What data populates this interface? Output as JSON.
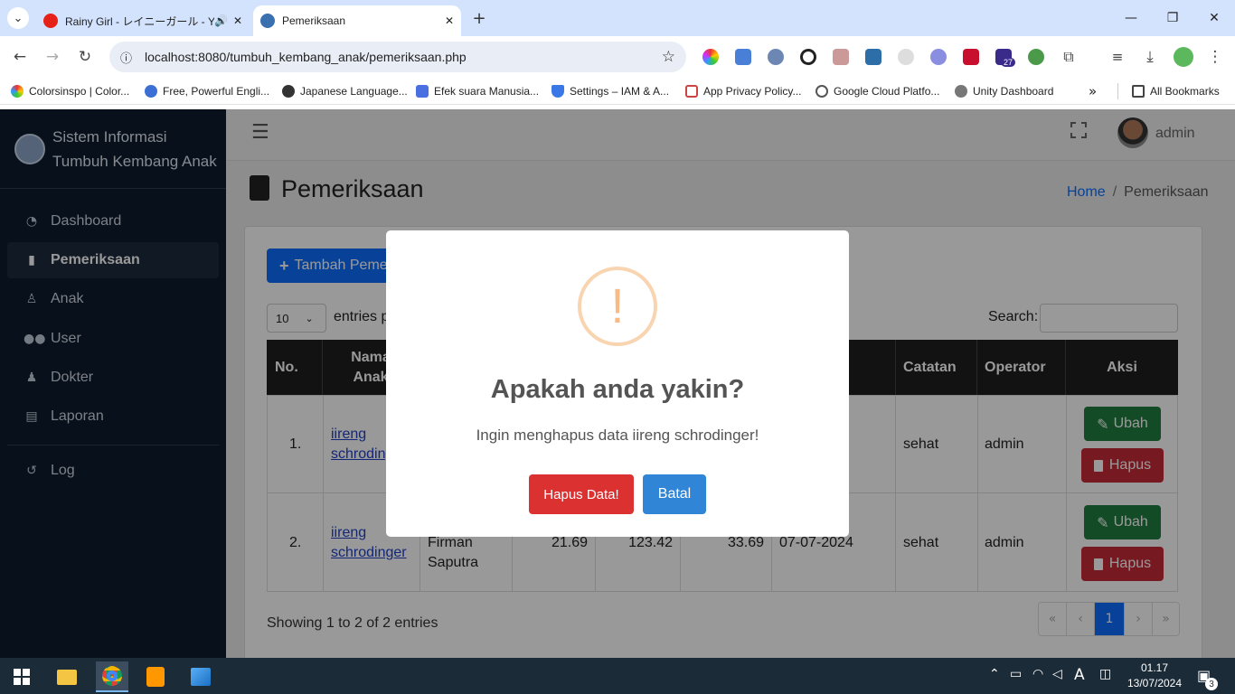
{
  "browser": {
    "tabs": [
      {
        "title": "Rainy Girl - レイニーガール - Yo",
        "active": false
      },
      {
        "title": "Pemeriksaan",
        "active": true
      }
    ],
    "url": "localhost:8080/tumbuh_kembang_anak/pemeriksaan.php",
    "bookmarks": [
      "Colorsinspo | Color...",
      "Free, Powerful Engli...",
      "Japanese Language...",
      "Efek suara Manusia...",
      "Settings – IAM & A...",
      "App Privacy Policy...",
      "Google Cloud Platfo...",
      "Unity Dashboard"
    ],
    "all_bookmarks": "All Bookmarks",
    "extension_badge": "27"
  },
  "sidebar": {
    "brand_line1": "Sistem Informasi",
    "brand_line2": "Tumbuh Kembang Anak",
    "items": [
      {
        "label": "Dashboard",
        "icon": "gauge-icon",
        "active": false
      },
      {
        "label": "Pemeriksaan",
        "icon": "clipboard-icon",
        "active": true
      },
      {
        "label": "Anak",
        "icon": "child-icon",
        "active": false
      },
      {
        "label": "User",
        "icon": "users-icon",
        "active": false
      },
      {
        "label": "Dokter",
        "icon": "doctor-icon",
        "active": false
      },
      {
        "label": "Laporan",
        "icon": "file-icon",
        "active": false
      }
    ],
    "log_label": "Log"
  },
  "header": {
    "username": "admin"
  },
  "page": {
    "title": "Pemeriksaan",
    "breadcrumb_home": "Home",
    "breadcrumb_sep": "/",
    "breadcrumb_current": "Pemeriksaan",
    "add_button": "Tambah Pemeriksaan",
    "entries_value": "10",
    "entries_label": "entries per page",
    "search_label": "Search:",
    "columns": [
      "No.",
      "Nama Anak",
      "Catatan",
      "Operator",
      "Aksi"
    ],
    "partial_column": "an",
    "rows": [
      {
        "no": "1.",
        "nama": "iireng schrodinger",
        "catatan": "sehat",
        "operator": "admin"
      },
      {
        "no": "2.",
        "nama": "iireng schrodinger",
        "dokter": "Firman Saputra",
        "v1": "21.69",
        "v2": "123.42",
        "v3": "33.69",
        "tanggal": "07-07-2024",
        "catatan": "sehat",
        "operator": "admin"
      }
    ],
    "edit_label": "Ubah",
    "delete_label": "Hapus",
    "showing": "Showing 1 to 2 of 2 entries",
    "pager": [
      "«",
      "‹",
      "1",
      "›",
      "»"
    ]
  },
  "modal": {
    "icon_glyph": "!",
    "title": "Apakah anda yakin?",
    "message": "Ingin menghapus data iireng schrodinger!",
    "confirm_label": "Hapus Data!",
    "cancel_label": "Batal"
  },
  "taskbar": {
    "time": "01.17",
    "date": "13/07/2024",
    "notification_count": "3"
  }
}
